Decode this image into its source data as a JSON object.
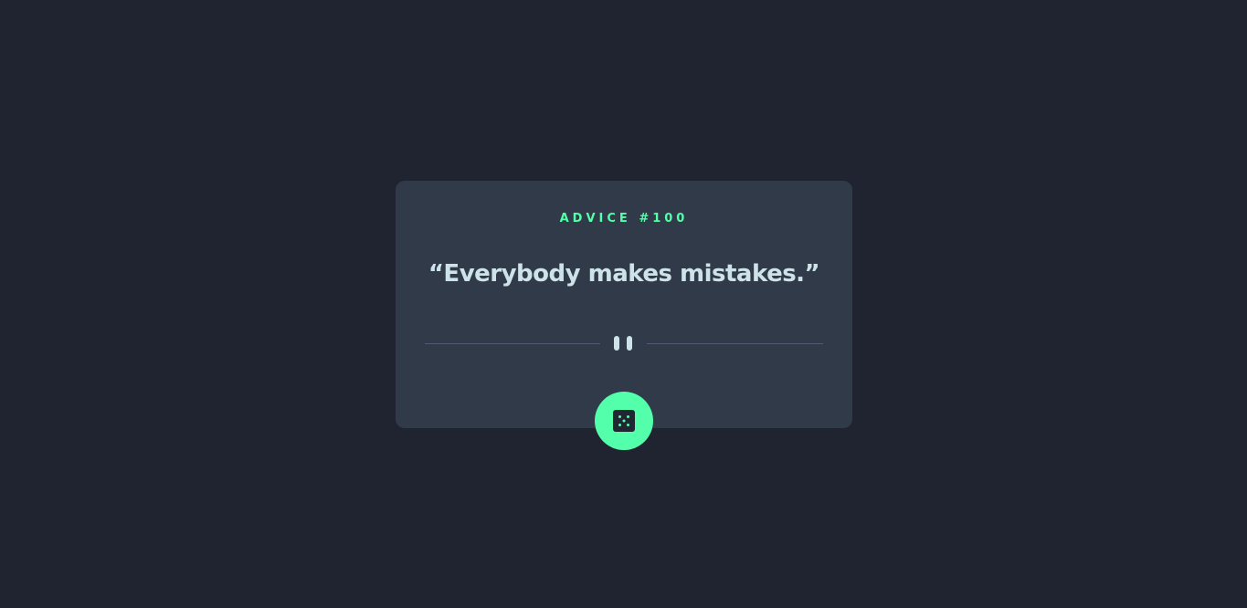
{
  "advice": {
    "label": "ADVICE #100",
    "quote": "“Everybody makes mistakes.”"
  },
  "icons": {
    "divider": "pause-icon",
    "button": "dice-icon"
  },
  "colors": {
    "background": "#1f2430",
    "card": "#313a48",
    "accent": "#53ffaa",
    "text": "#cee3e9",
    "divider_line": "#4f5d74"
  }
}
